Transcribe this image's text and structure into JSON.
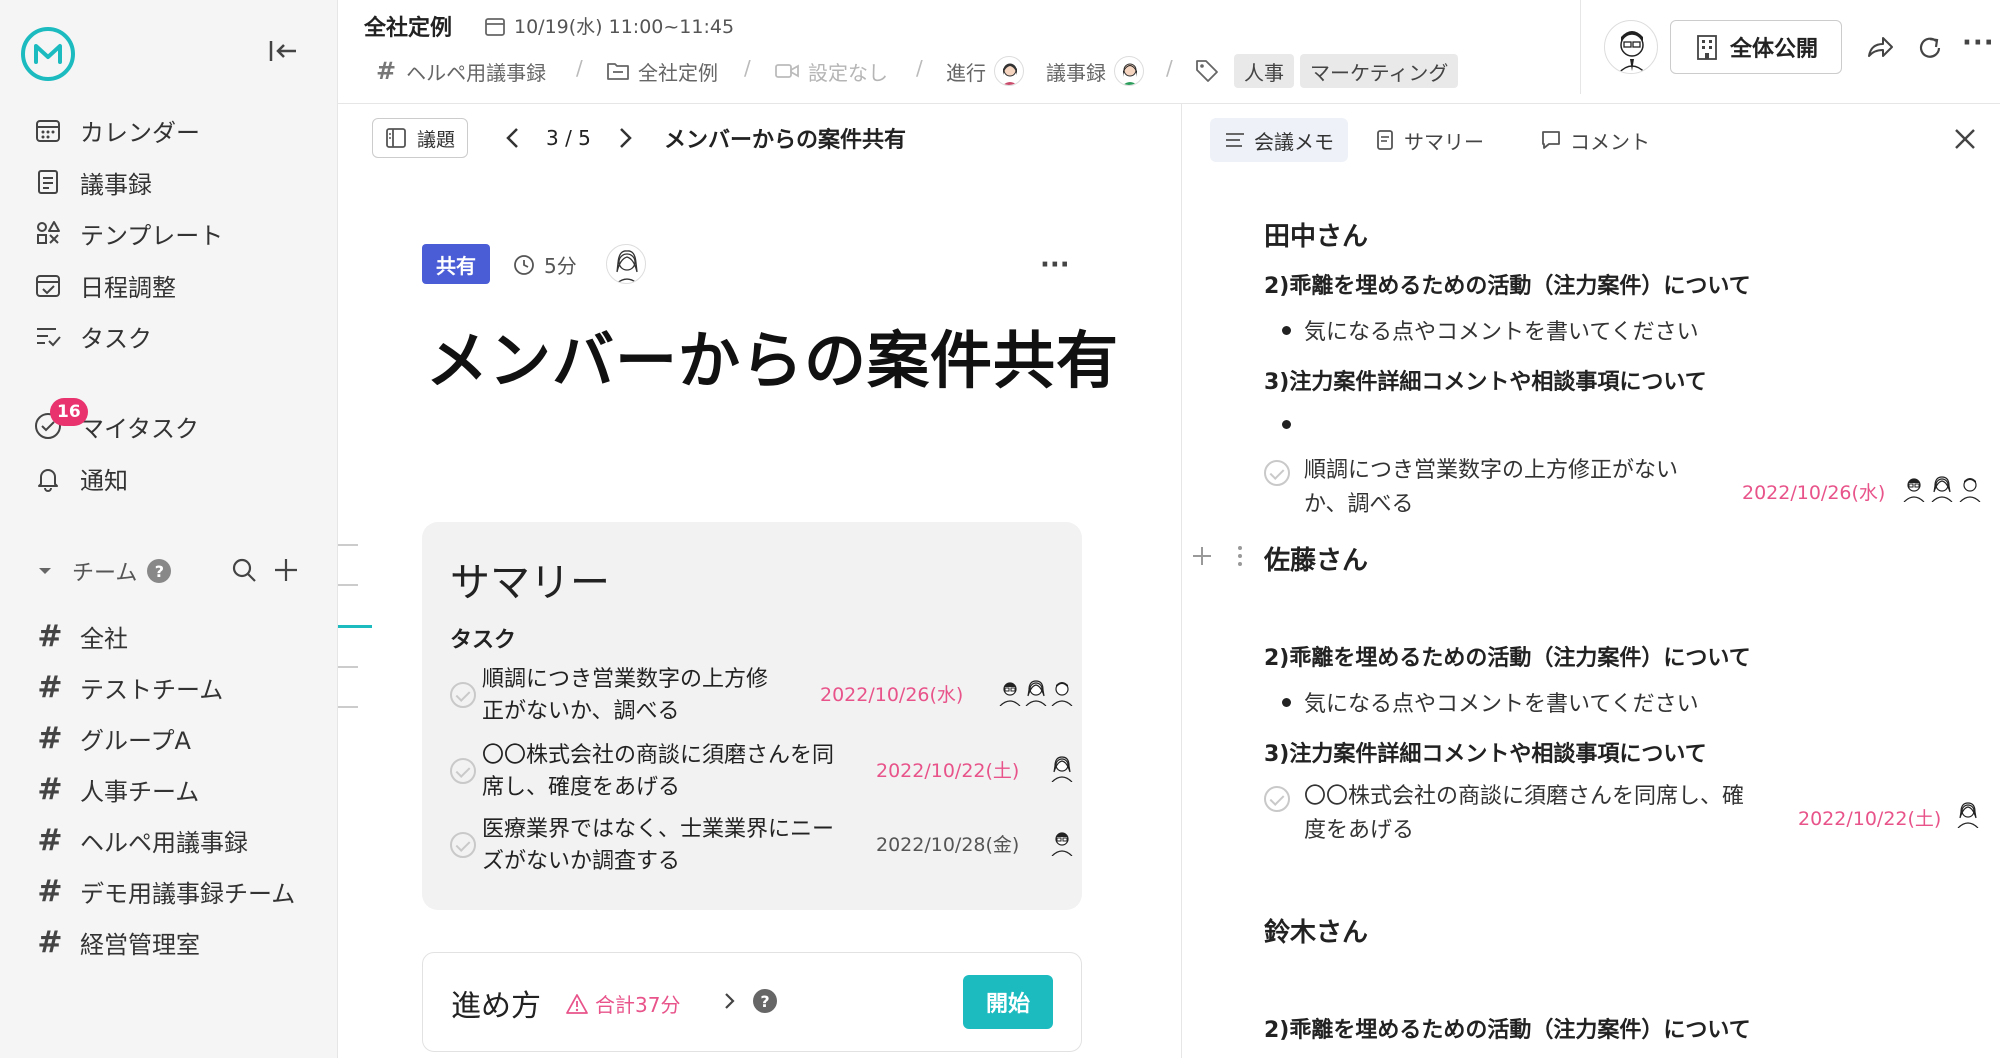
{
  "sidebar": {
    "nav": [
      {
        "label": "カレンダー",
        "icon": "calendar-icon"
      },
      {
        "label": "議事録",
        "icon": "document-icon"
      },
      {
        "label": "テンプレート",
        "icon": "template-icon"
      },
      {
        "label": "日程調整",
        "icon": "schedule-icon"
      },
      {
        "label": "タスク",
        "icon": "task-list-icon"
      }
    ],
    "mytask": {
      "label": "マイタスク",
      "badge": "16"
    },
    "notice": {
      "label": "通知"
    },
    "team_label": "チーム",
    "teams": [
      {
        "label": "全社",
        "icon": "hash"
      },
      {
        "label": "テストチーム",
        "icon": "hash"
      },
      {
        "label": "グループA",
        "icon": "hash-lock"
      },
      {
        "label": "人事チーム",
        "icon": "hash-lock"
      },
      {
        "label": "ヘルペ用議事録",
        "icon": "hash"
      },
      {
        "label": "デモ用議事録チーム",
        "icon": "hash"
      },
      {
        "label": "経営管理室",
        "icon": "hash"
      }
    ]
  },
  "header": {
    "title": "全社定例",
    "datetime": "10/19(水) 11:00~11:45",
    "crumbs": {
      "team": "ヘルペ用議事録",
      "folder": "全社定例",
      "video": "設定なし",
      "facilitator": "進行",
      "minutes": "議事録"
    },
    "tags": [
      "人事",
      "マーケティング"
    ],
    "visibility": "全体公開"
  },
  "agenda_bar": {
    "button": "議題",
    "pager": "3 / 5",
    "current_title": "メンバーからの案件共有"
  },
  "agenda": {
    "badge": "共有",
    "duration": "5分",
    "title": "メンバーからの案件共有"
  },
  "summary": {
    "title": "サマリー",
    "tasks_label": "タスク",
    "tasks": [
      {
        "line1": "順調につき営業数字の上方修",
        "line2": "正がないか、調べる",
        "date": "2022/10/26(水)"
      },
      {
        "line1": "〇〇株式会社の商談に須磨さんを同",
        "line2": "席し、確度をあげる",
        "date": "2022/10/22(土)"
      },
      {
        "line1": "医療業界ではなく、士業業界にニー",
        "line2": "ズがないか調査する",
        "date": "2022/10/28(金)"
      }
    ]
  },
  "progress": {
    "label": "進め方",
    "total": "合計37分",
    "start": "開始"
  },
  "right": {
    "tabs": [
      "会議メモ",
      "サマリー",
      "コメント"
    ],
    "sections": {
      "tanaka": "田中さん",
      "sato": "佐藤さん",
      "suzuki": "鈴木さん",
      "h2": "2)乖離を埋めるための活動（注力案件）について",
      "h3": "3)注力案件詳細コメントや相談事項について",
      "bullet": "気になる点やコメントを書いてください",
      "task1_line1": "順調につき営業数字の上方修正がない",
      "task1_line2": "か、調べる",
      "task1_date": "2022/10/26(水)",
      "task2_line1": "〇〇株式会社の商談に須磨さんを同席し、確",
      "task2_line2": "度をあげる",
      "task2_date": "2022/10/22(土)"
    }
  },
  "colors": {
    "accent": "#1bbbc0",
    "share_badge": "#4b5dd6",
    "date_pink": "#e8548a",
    "badge_red": "#e8336e"
  }
}
